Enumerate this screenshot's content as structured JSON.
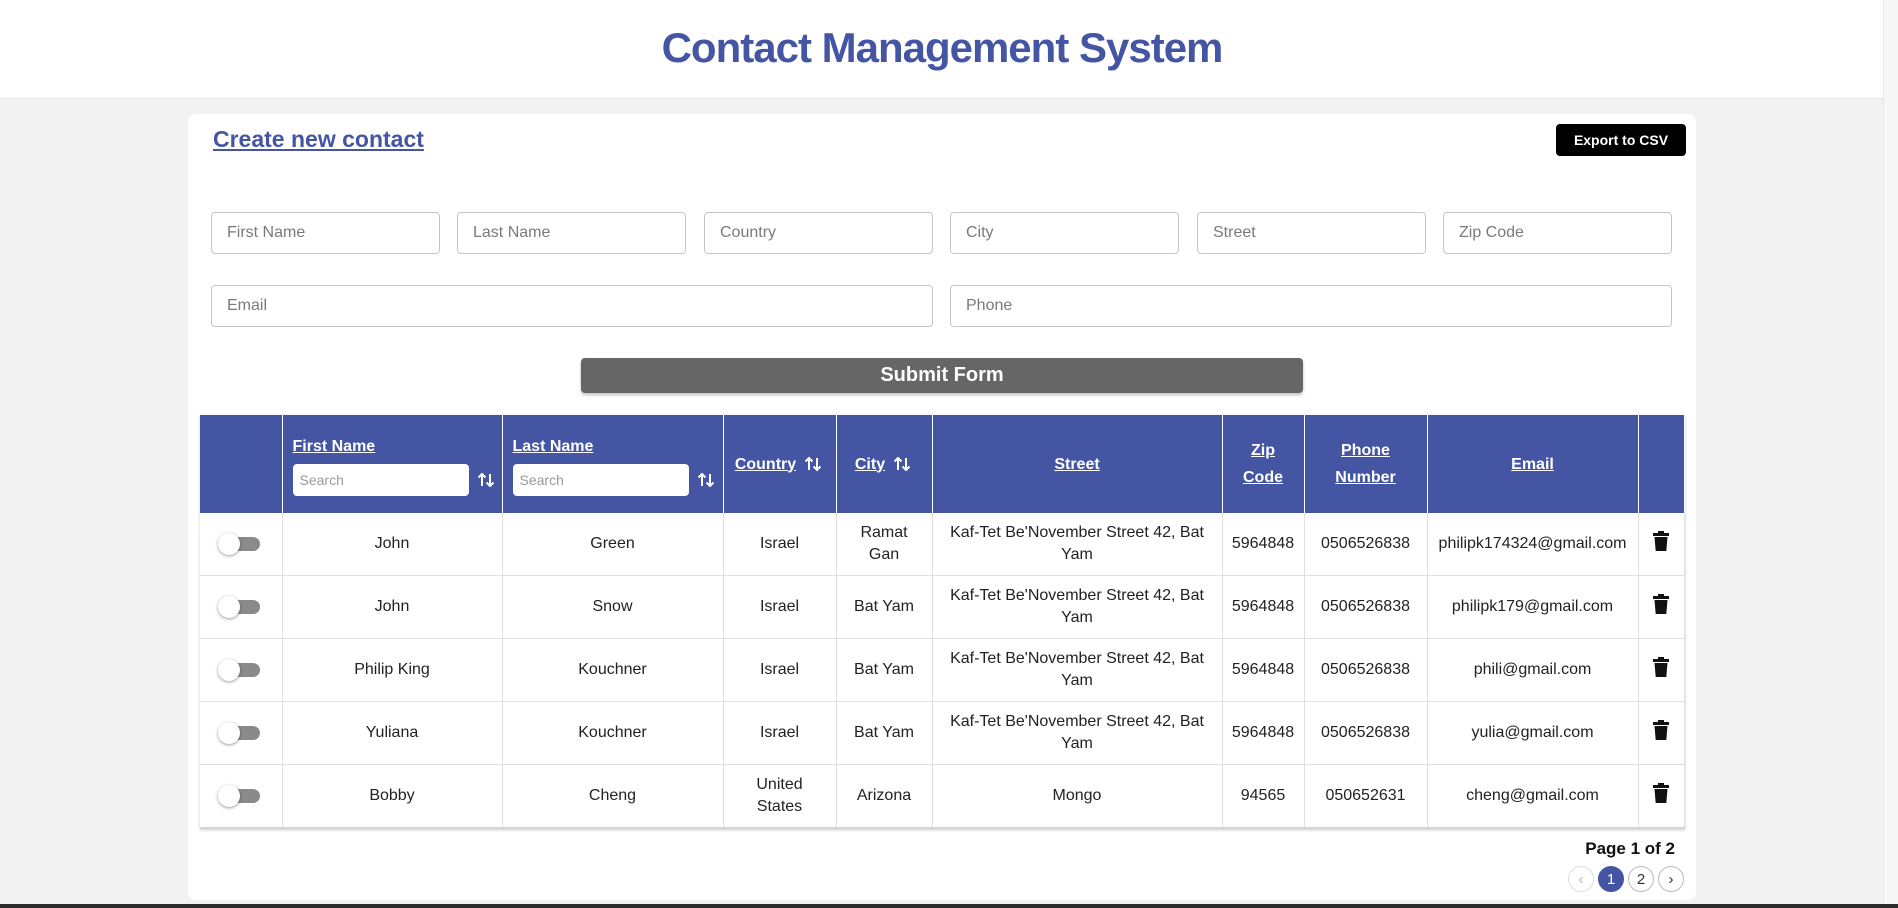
{
  "header": {
    "title": "Contact Management System"
  },
  "form": {
    "create_link": "Create new contact",
    "export_label": "Export to CSV",
    "placeholders": {
      "first_name": "First Name",
      "last_name": "Last Name",
      "country": "Country",
      "city": "City",
      "street": "Street",
      "zip": "Zip Code",
      "email": "Email",
      "phone": "Phone"
    },
    "submit_label": "Submit Form"
  },
  "table": {
    "headers": {
      "first_name": "First Name",
      "last_name": "Last Name",
      "country": "Country",
      "city": "City",
      "street": "Street",
      "zip": "Zip Code",
      "phone": "Phone Number",
      "email": "Email"
    },
    "search_placeholder": "Search",
    "rows": [
      {
        "first": "John",
        "last": "Green",
        "country": "Israel",
        "city": "Ramat Gan",
        "street": "Kaf-Tet Be'November Street 42, Bat Yam",
        "zip": "5964848",
        "phone": "0506526838",
        "email": "philipk174324@gmail.com"
      },
      {
        "first": "John",
        "last": "Snow",
        "country": "Israel",
        "city": "Bat Yam",
        "street": "Kaf-Tet Be'November Street 42, Bat Yam",
        "zip": "5964848",
        "phone": "0506526838",
        "email": "philipk179@gmail.com"
      },
      {
        "first": "Philip King",
        "last": "Kouchner",
        "country": "Israel",
        "city": "Bat Yam",
        "street": "Kaf-Tet Be'November Street 42, Bat Yam",
        "zip": "5964848",
        "phone": "0506526838",
        "email": "phili@gmail.com"
      },
      {
        "first": "Yuliana",
        "last": "Kouchner",
        "country": "Israel",
        "city": "Bat Yam",
        "street": "Kaf-Tet Be'November Street 42, Bat Yam",
        "zip": "5964848",
        "phone": "0506526838",
        "email": "yulia@gmail.com"
      },
      {
        "first": "Bobby",
        "last": "Cheng",
        "country": "United States",
        "city": "Arizona",
        "street": "Mongo",
        "zip": "94565",
        "phone": "050652631",
        "email": "cheng@gmail.com"
      }
    ]
  },
  "pagination": {
    "label": "Page 1 of 2",
    "pages": [
      "1",
      "2"
    ],
    "current": "1",
    "prev_icon": "‹",
    "next_icon": "›"
  },
  "colors": {
    "accent": "#4455a4",
    "submit": "#666666",
    "export": "#000000"
  },
  "icons": {
    "sort": "sort-arrows-icon",
    "delete": "trash-icon",
    "prev": "chevron-left-icon",
    "next": "chevron-right-icon"
  }
}
